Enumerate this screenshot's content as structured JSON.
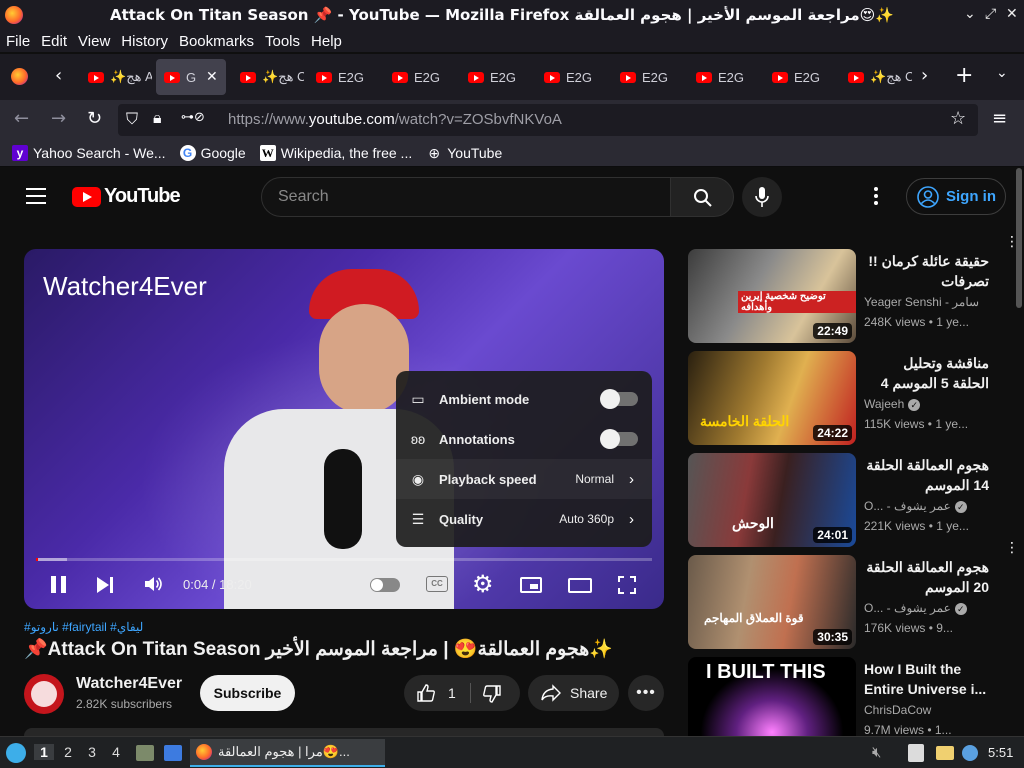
{
  "window": {
    "title": "Attack On Titan Season 📌 - YouTube — Mozilla Firefox مراجعة الموسم الأخير | هجوم العمالقة😍✨"
  },
  "menu": [
    "File",
    "Edit",
    "View",
    "History",
    "Bookmarks",
    "Tools",
    "Help"
  ],
  "tabs": [
    {
      "label": "✨هج AYING",
      "active": false
    },
    {
      "label": "G",
      "active": true
    },
    {
      "label": "✨هج CKED",
      "active": false
    },
    {
      "label": "E2G",
      "active": false
    },
    {
      "label": "E2G",
      "active": false
    },
    {
      "label": "E2G",
      "active": false
    },
    {
      "label": "E2G",
      "active": false
    },
    {
      "label": "E2G",
      "active": false
    },
    {
      "label": "E2G",
      "active": false
    },
    {
      "label": "E2G",
      "active": false
    },
    {
      "label": "✨هج CKED",
      "active": false
    }
  ],
  "url": {
    "prefix": "https://www.",
    "domain": "youtube.com",
    "path": "/watch?v=ZOSbvfNKVoA"
  },
  "bookmarks": [
    {
      "label": "Yahoo Search - We...",
      "icon": "yahoo-icon"
    },
    {
      "label": "Google",
      "icon": "google-icon"
    },
    {
      "label": "Wikipedia, the free ...",
      "icon": "wikipedia-icon"
    },
    {
      "label": "YouTube",
      "icon": "globe-icon"
    }
  ],
  "youtube": {
    "logo_text": "YouTube",
    "search_placeholder": "Search",
    "sign_in": "Sign in"
  },
  "player": {
    "watermark": "Watcher4Ever",
    "time": "0:04 / 18:20",
    "progress_played": 0.004,
    "progress_buffered": 0.05,
    "settings": [
      {
        "label": "Ambient mode",
        "type": "toggle",
        "value": ""
      },
      {
        "label": "Annotations",
        "type": "toggle",
        "value": ""
      },
      {
        "label": "Playback speed",
        "type": "submenu",
        "value": "Normal"
      },
      {
        "label": "Quality",
        "type": "submenu",
        "value": "Auto 360p"
      }
    ]
  },
  "video": {
    "hashtags": "#ناروتو #fairytail #ليفاي",
    "title": "📌Attack On Titan Season هجوم العمالقة😍 | مراجعة الموسم الأخير✨",
    "channel": "Watcher4Ever",
    "subscribers": "2.82K subscribers",
    "subscribe": "Subscribe",
    "likes": "1",
    "share": "Share"
  },
  "recommendations": [
    {
      "title": "حقيقة عائلة كرمان !! تصرفات",
      "channel": "Yeager Senshi - سامر",
      "meta": "248K views  • 1 ye...",
      "duration": "22:49",
      "thumb_text": "توضيح شخصية إيرين وأهدافه",
      "verified": false
    },
    {
      "title": "مناقشة وتحليل الحلقة 5 الموسم 4",
      "channel": "Wajeeh",
      "meta": "115K views  • 1 ye...",
      "duration": "24:22",
      "thumb_text": "الحلقة الخامسة",
      "verified": true
    },
    {
      "title": "هجوم العمالقة الحلقة 14 الموسم",
      "channel": "O... - عمر يشوف",
      "meta": "221K views  • 1 ye...",
      "duration": "24:01",
      "thumb_text": "الوحش",
      "verified": true
    },
    {
      "title": "هجوم العمالقة الحلقة 20 الموسم",
      "channel": "O... - عمر يشوف",
      "meta": "176K views  • 9...",
      "duration": "30:35",
      "thumb_text": "قوة العملاق المهاجم",
      "verified": true
    },
    {
      "title": "How I Built the Entire Universe i...",
      "channel": "ChrisDaCow",
      "meta": "9.7M views  • 1...",
      "duration": "",
      "thumb_text": "I BUILT THIS",
      "verified": false
    }
  ],
  "taskbar": {
    "workspaces": [
      "1",
      "2",
      "3",
      "4"
    ],
    "window_label": "مرا | هجوم العمالقة😍...",
    "clock": "5:51"
  }
}
